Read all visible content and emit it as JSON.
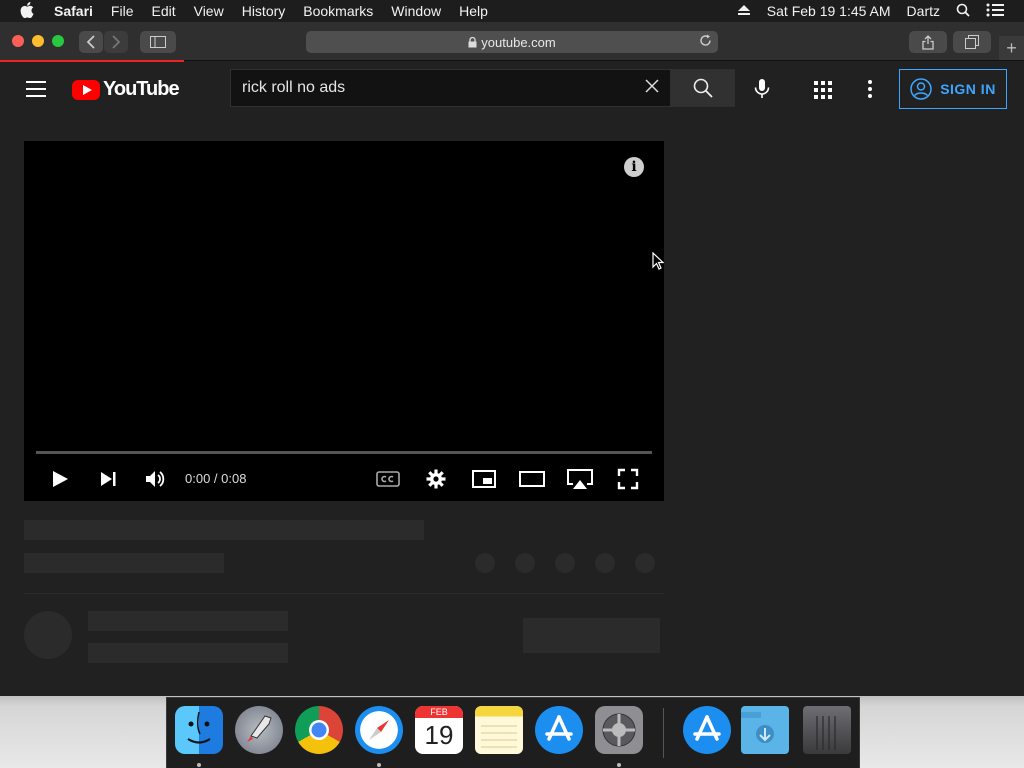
{
  "menubar": {
    "app_name": "Safari",
    "items": [
      "File",
      "Edit",
      "View",
      "History",
      "Bookmarks",
      "Window",
      "Help"
    ],
    "datetime": "Sat Feb 19  1:45 AM",
    "user": "Dartz"
  },
  "browser": {
    "url": "youtube.com"
  },
  "youtube": {
    "logo_text": "YouTube",
    "search_query": "rick roll no ads",
    "sign_in_label": "SIGN IN",
    "accent_color": "#3ea6ff",
    "brand_color": "#ff0000"
  },
  "player": {
    "time": "0:00 / 0:08",
    "info_glyph": "i"
  },
  "dock": {
    "calendar_month": "FEB",
    "calendar_day": "19",
    "apps": [
      "finder",
      "launchpad",
      "chrome",
      "safari",
      "calendar",
      "notes",
      "app-store",
      "system-preferences",
      "app-store-download",
      "downloads-folder",
      "trash"
    ]
  }
}
